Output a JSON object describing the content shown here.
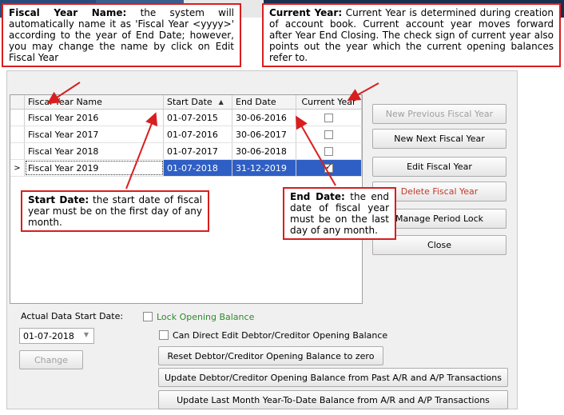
{
  "callouts": {
    "fiscal_year_name": {
      "title": "Fiscal Year Name:",
      "text": " the system will automatically name it as 'Fiscal Year <yyyy>' according to the year of End Date; however, you may change the name by click on Edit Fiscal Year"
    },
    "current_year": {
      "title": "Current Year:",
      "text": " Current Year is determined during creation of account book. Current account year moves forward after Year End Closing. The check sign of current year also points out the year which the current opening balances refer to."
    },
    "start_date": {
      "title": "Start Date:",
      "text": " the start date of fiscal year must be on the first day of any month."
    },
    "end_date": {
      "title": "End Date:",
      "text": " the end date of fiscal year must be on the last day of any month."
    }
  },
  "grid": {
    "headers": {
      "name": "Fiscal Year Name",
      "start": "Start Date",
      "end": "End Date",
      "current": "Current Year"
    },
    "rows": [
      {
        "name": "Fiscal Year 2016",
        "start": "01-07-2015",
        "end": "30-06-2016",
        "current": false
      },
      {
        "name": "Fiscal Year 2017",
        "start": "01-07-2016",
        "end": "30-06-2017",
        "current": false
      },
      {
        "name": "Fiscal Year 2018",
        "start": "01-07-2017",
        "end": "30-06-2018",
        "current": false
      },
      {
        "name": "Fiscal Year 2019",
        "start": "01-07-2018",
        "end": "31-12-2019",
        "current": true
      }
    ]
  },
  "buttons": {
    "new_previous": "New Previous Fiscal Year",
    "new_next": "New Next Fiscal Year",
    "edit": "Edit Fiscal Year",
    "delete": "Delete Fiscal Year",
    "period_lock": "Manage Period Lock",
    "close": "Close"
  },
  "bottom": {
    "actual_data_label": "Actual Data Start Date:",
    "actual_data_value": "01-07-2018",
    "change": "Change",
    "lock_opening": "Lock Opening Balance",
    "can_direct_edit": "Can Direct Edit Debtor/Creditor Opening Balance",
    "reset": "Reset Debtor/Creditor Opening Balance to zero",
    "update_past": "Update Debtor/Creditor Opening Balance from Past A/R and A/P Transactions",
    "update_ytd": "Update Last Month Year-To-Date Balance from A/R and A/P Transactions"
  },
  "colors": {
    "accent": "#d81e1e",
    "selection": "#2f5fc4"
  }
}
